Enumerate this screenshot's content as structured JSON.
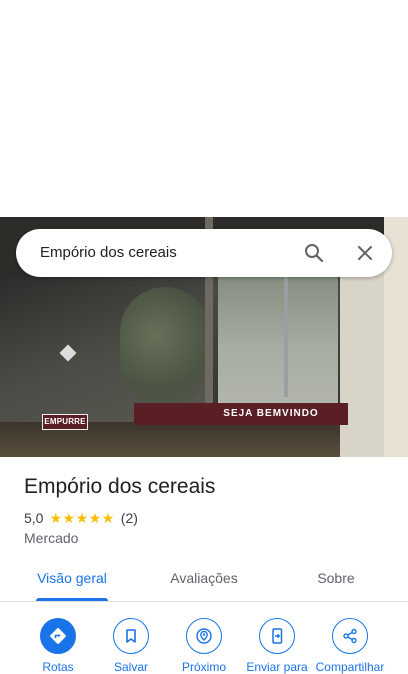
{
  "search": {
    "query": "Empório dos cereais"
  },
  "photo": {
    "sign_left": "EMPURRE",
    "sign_right": "SEJA BEMVINDO"
  },
  "place": {
    "name": "Empório dos cereais",
    "rating": "5,0",
    "stars": 5,
    "review_count": "(2)",
    "category": "Mercado"
  },
  "tabs": [
    {
      "label": "Visão geral",
      "active": true
    },
    {
      "label": "Avaliações",
      "active": false
    },
    {
      "label": "Sobre",
      "active": false
    }
  ],
  "actions": [
    {
      "label": "Rotas",
      "icon": "directions-icon"
    },
    {
      "label": "Salvar",
      "icon": "bookmark-icon"
    },
    {
      "label": "Próximo",
      "icon": "nearby-icon"
    },
    {
      "label": "Enviar para",
      "icon": "send-to-phone-icon"
    },
    {
      "label": "Compartilhar",
      "icon": "share-icon"
    }
  ],
  "colors": {
    "accent": "#1a73e8",
    "star": "#fbbc04",
    "sign": "#5a1f24"
  }
}
